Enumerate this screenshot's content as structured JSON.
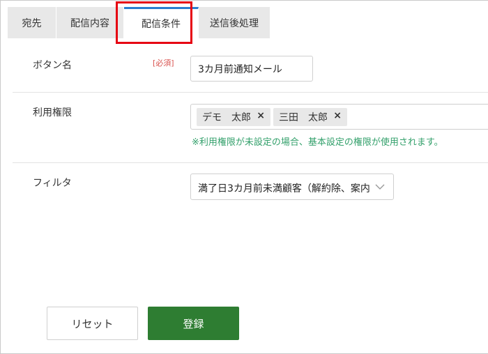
{
  "tabs": [
    {
      "label": "宛先"
    },
    {
      "label": "配信内容"
    },
    {
      "label": "配信条件"
    },
    {
      "label": "送信後処理"
    }
  ],
  "active_tab": "配信条件",
  "form": {
    "button_name": {
      "label": "ボタン名",
      "required_badge": "[必須]",
      "value": "3カ月前通知メール"
    },
    "permission": {
      "label": "利用権限",
      "tags": [
        "デモ　太郎",
        "三田　太郎"
      ],
      "remove_glyph": "×",
      "note": "※利用権限が未設定の場合、基本設定の権限が使用されます。"
    },
    "filter": {
      "label": "フィルタ",
      "selected": "満了日3カ月前未満顧客（解約除、案内"
    }
  },
  "buttons": {
    "reset": "リセット",
    "submit": "登録"
  },
  "colors": {
    "active_tab_accent": "#2a7ed0",
    "highlight_box": "#e60012",
    "submit_green": "#2e7d32",
    "note_green": "#33a06b",
    "required_red": "#d9534f"
  }
}
